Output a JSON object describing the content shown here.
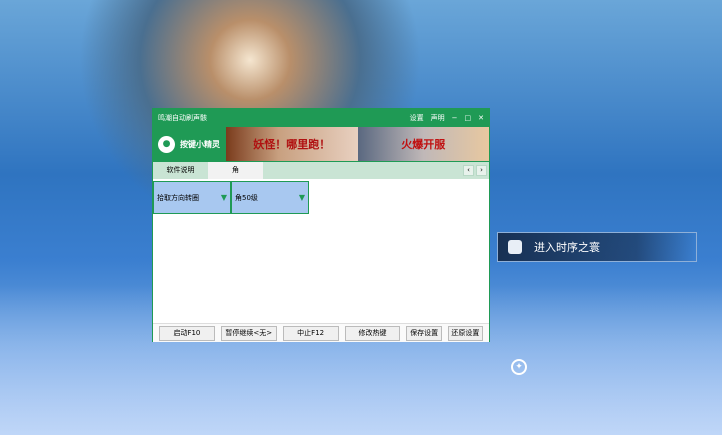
{
  "window": {
    "title": "鸣潮自动刷声骸",
    "settings": "设置",
    "about": "声明",
    "minimize": "−",
    "maximize": "□",
    "close": "✕"
  },
  "header": {
    "logo_text": "按键小精灵",
    "banner1": "妖怪！哪里跑！",
    "banner2": "火爆开服"
  },
  "tabs": [
    {
      "label": "软件说明"
    },
    {
      "label": "角"
    }
  ],
  "nav": {
    "prev": "‹",
    "next": "›"
  },
  "dropdowns": [
    {
      "value": "拾取方向转圈"
    },
    {
      "value": "角50级"
    }
  ],
  "buttons": {
    "start": "启动F10",
    "pause": "暂停继续<无>",
    "stop": "中止F12",
    "hotkey": "修改热键",
    "save": "保存设置",
    "restore": "还原设置"
  },
  "game": {
    "prompt": "进入时序之寰"
  }
}
